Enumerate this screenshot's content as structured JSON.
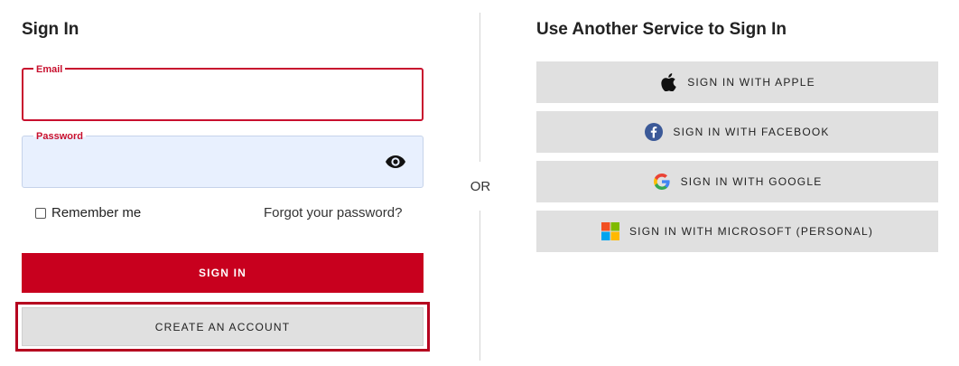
{
  "signin": {
    "heading": "Sign In",
    "email_label": "Email",
    "email_value": "",
    "password_label": "Password",
    "password_value": "",
    "remember_label": "Remember me",
    "remember_checked": false,
    "forgot_label": "Forgot your password?",
    "signin_button": "SIGN IN",
    "create_button": "CREATE AN ACCOUNT"
  },
  "divider": {
    "or_label": "OR"
  },
  "services": {
    "heading": "Use Another Service to Sign In",
    "items": [
      {
        "label": "SIGN IN WITH APPLE",
        "icon": "apple-icon"
      },
      {
        "label": "SIGN IN WITH FACEBOOK",
        "icon": "facebook-icon"
      },
      {
        "label": "SIGN IN WITH GOOGLE",
        "icon": "google-icon"
      },
      {
        "label": "SIGN IN WITH MICROSOFT (PERSONAL)",
        "icon": "microsoft-icon"
      }
    ]
  },
  "colors": {
    "brand_red": "#c8001e",
    "button_gray": "#e0e0e0",
    "autofill_blue": "#e8f0fe"
  }
}
